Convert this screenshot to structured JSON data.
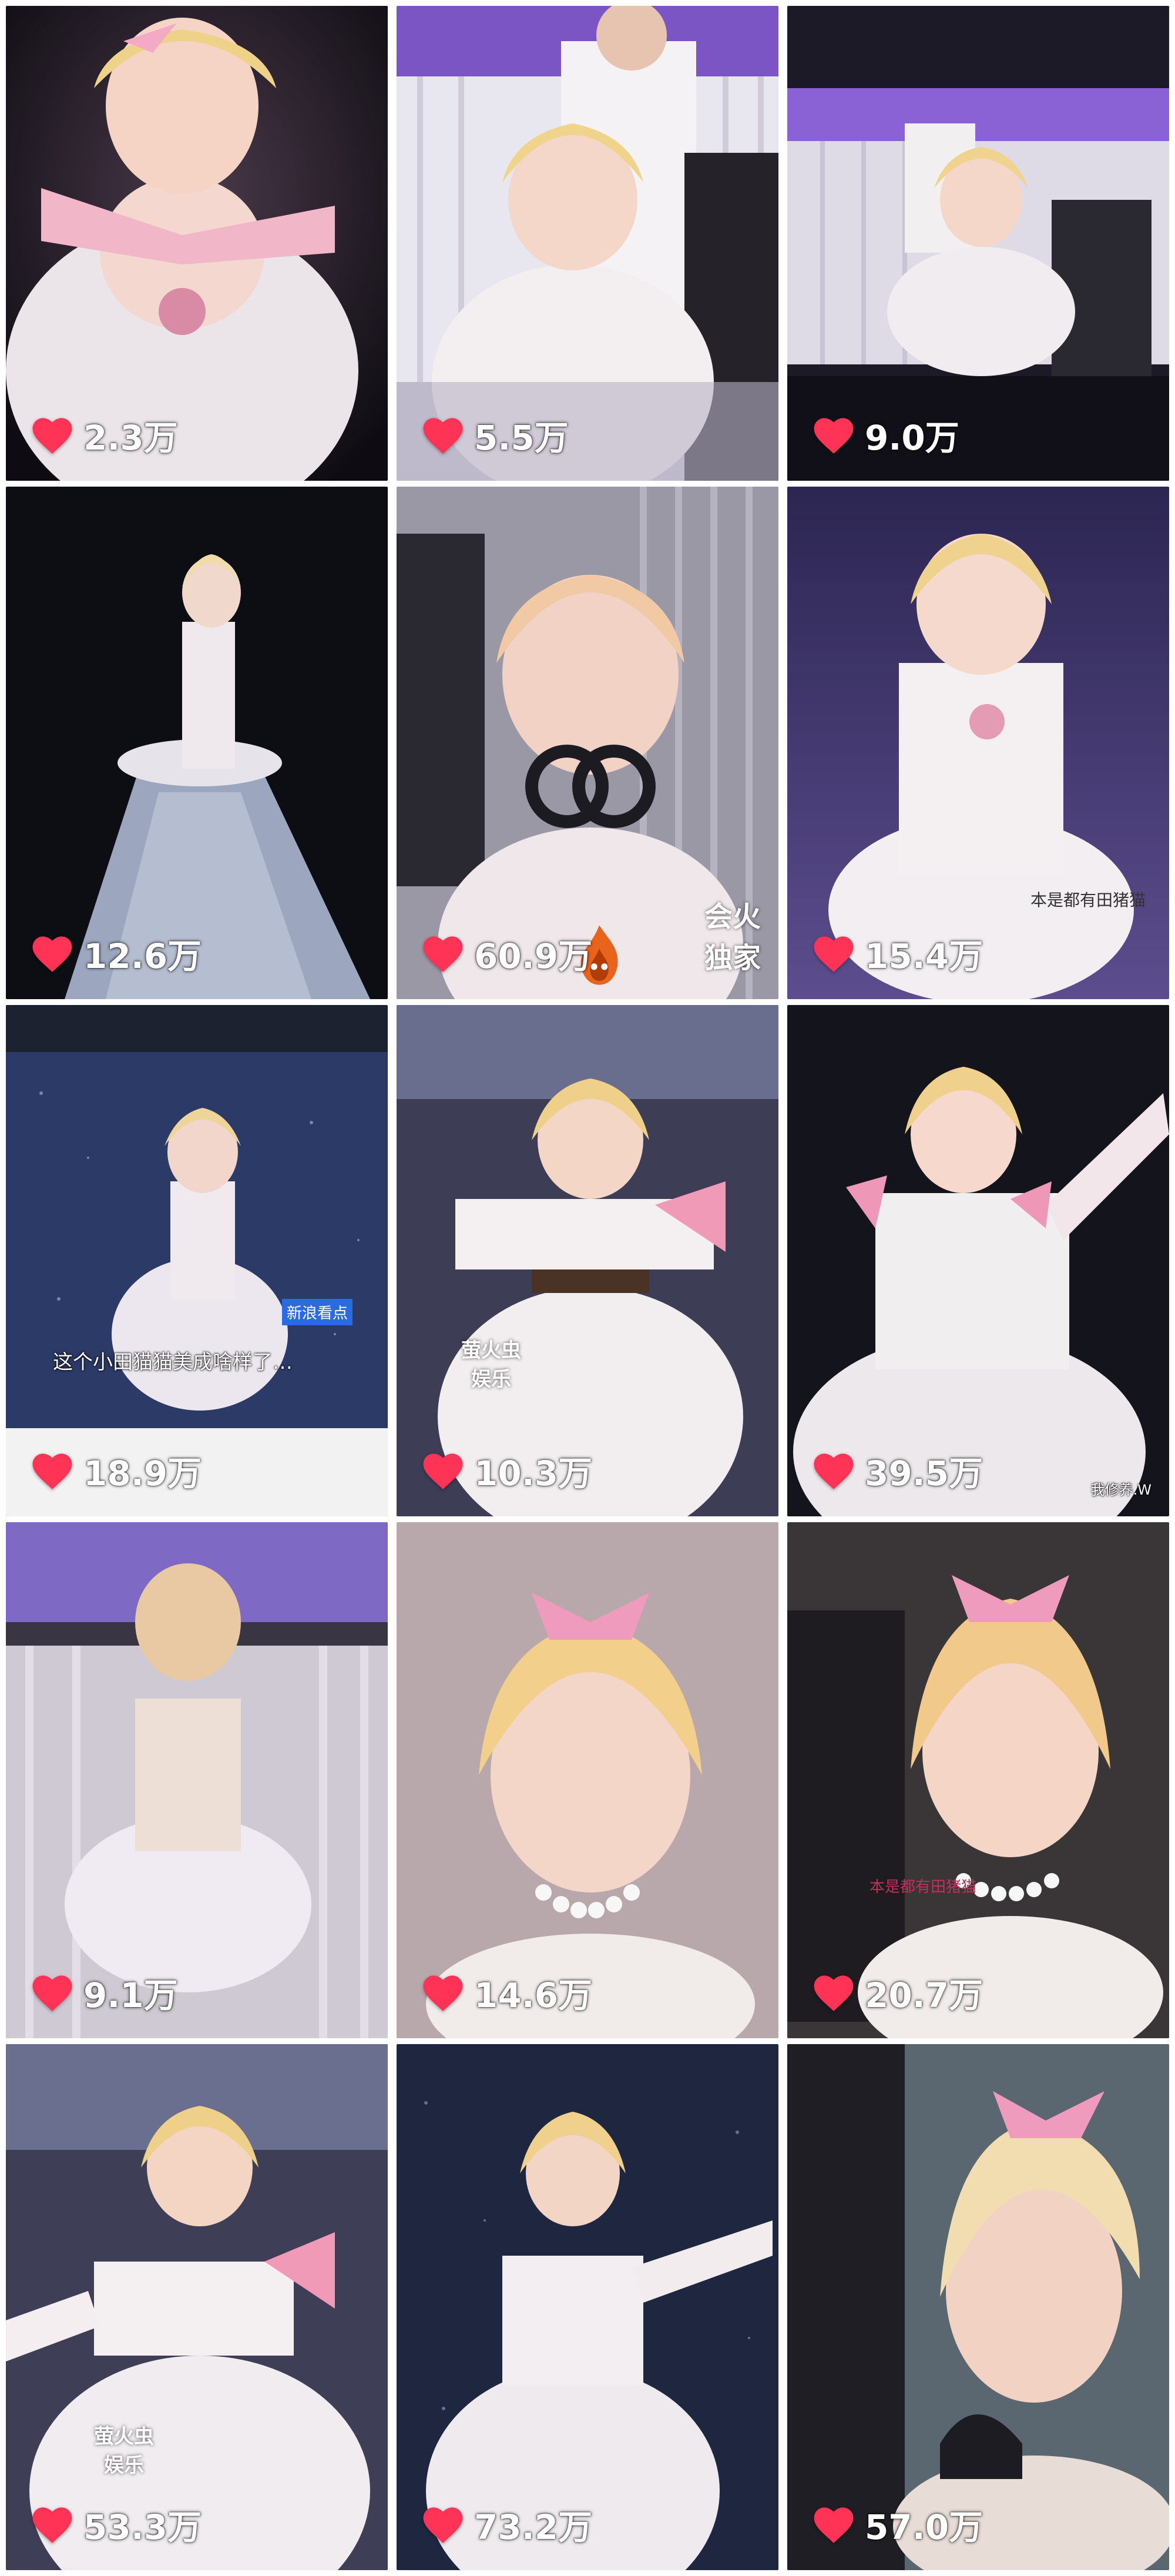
{
  "colors": {
    "heart": "#ff3355",
    "text": "#ffffff",
    "divider": "#ffffff"
  },
  "tiles": [
    {
      "likes": "2.3万"
    },
    {
      "likes": "5.5万"
    },
    {
      "likes": "9.0万"
    },
    {
      "likes": "12.6万"
    },
    {
      "likes": "60.9万"
    },
    {
      "likes": "15.4万"
    },
    {
      "likes": "18.9万"
    },
    {
      "likes": "10.3万"
    },
    {
      "likes": "39.5万"
    },
    {
      "likes": "9.1万"
    },
    {
      "likes": "14.6万"
    },
    {
      "likes": "20.7万"
    },
    {
      "likes": "53.3万"
    },
    {
      "likes": "73.2万"
    },
    {
      "likes": "57.0万"
    }
  ],
  "overlays": {
    "t5_brand_line1": "会火",
    "t5_brand_line2": "独家",
    "t6_caption": "本是都有田猪猫",
    "t7_subtitle": "这个小田猫猫美成啥样了…",
    "t7_tag": "新浪看点",
    "t8_brand_line1": "萤火虫",
    "t8_brand_line2": "娱乐",
    "t9_caption": "我修养.W",
    "t12_caption": "本是都有田猪猫",
    "t13_brand_line1": "萤火虫",
    "t13_brand_line2": "娱乐"
  },
  "icons": {
    "like": "heart-icon",
    "brand": "flame-mascot-icon"
  }
}
